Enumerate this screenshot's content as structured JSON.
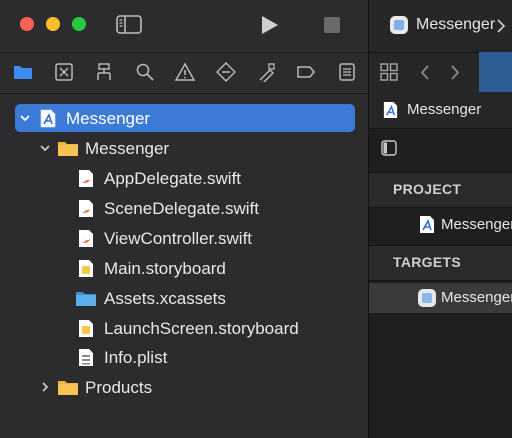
{
  "window": {
    "traffic_lights": [
      "close",
      "minimize",
      "zoom"
    ]
  },
  "toolbar": {
    "icons": [
      "sidebar-toggle-icon",
      "run-icon",
      "stop-icon"
    ]
  },
  "navigator_tabs": [
    "folder-icon",
    "source-control-icon",
    "hierarchy-icon",
    "search-icon",
    "warning-icon",
    "test-icon",
    "debug-icon",
    "breakpoint-icon",
    "report-icon"
  ],
  "tree": {
    "project": "Messenger",
    "group": "Messenger",
    "files": [
      "AppDelegate.swift",
      "SceneDelegate.swift",
      "ViewController.swift",
      "Main.storyboard",
      "Assets.xcassets",
      "LaunchScreen.storyboard",
      "Info.plist"
    ],
    "products": "Products"
  },
  "editor": {
    "tab_title": "Messenger",
    "breadcrumb": "Messenger",
    "project_header": "PROJECT",
    "project_item": "Messenger",
    "targets_header": "TARGETS",
    "target_item": "Messenger"
  },
  "colors": {
    "selection": "#3b7ad6",
    "swift": "#f05138",
    "folder": "#f0b43c",
    "assets_folder": "#4aa3e0"
  }
}
